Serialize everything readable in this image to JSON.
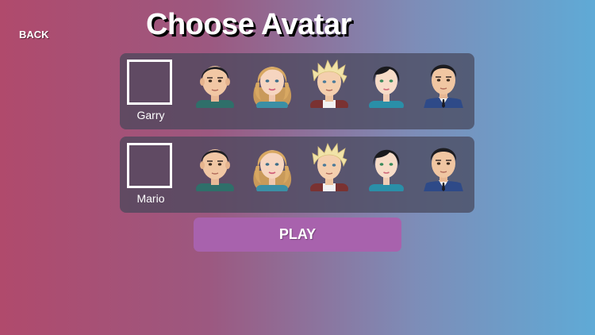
{
  "nav": {
    "back_label": "BACK"
  },
  "header": {
    "title": "Choose Avatar"
  },
  "players": [
    {
      "name": "Garry"
    },
    {
      "name": "Mario"
    }
  ],
  "avatar_options": [
    "dark-haired-boy-avatar",
    "blonde-girl-avatar",
    "blond-boy-avatar",
    "dark-haired-girl-avatar",
    "suited-man-avatar"
  ],
  "actions": {
    "play_label": "PLAY"
  },
  "colors": {
    "play_button": "#a862ad",
    "panel": "#4a4a5a",
    "gradient_left": "#b04a6c",
    "gradient_right": "#5faad6"
  }
}
